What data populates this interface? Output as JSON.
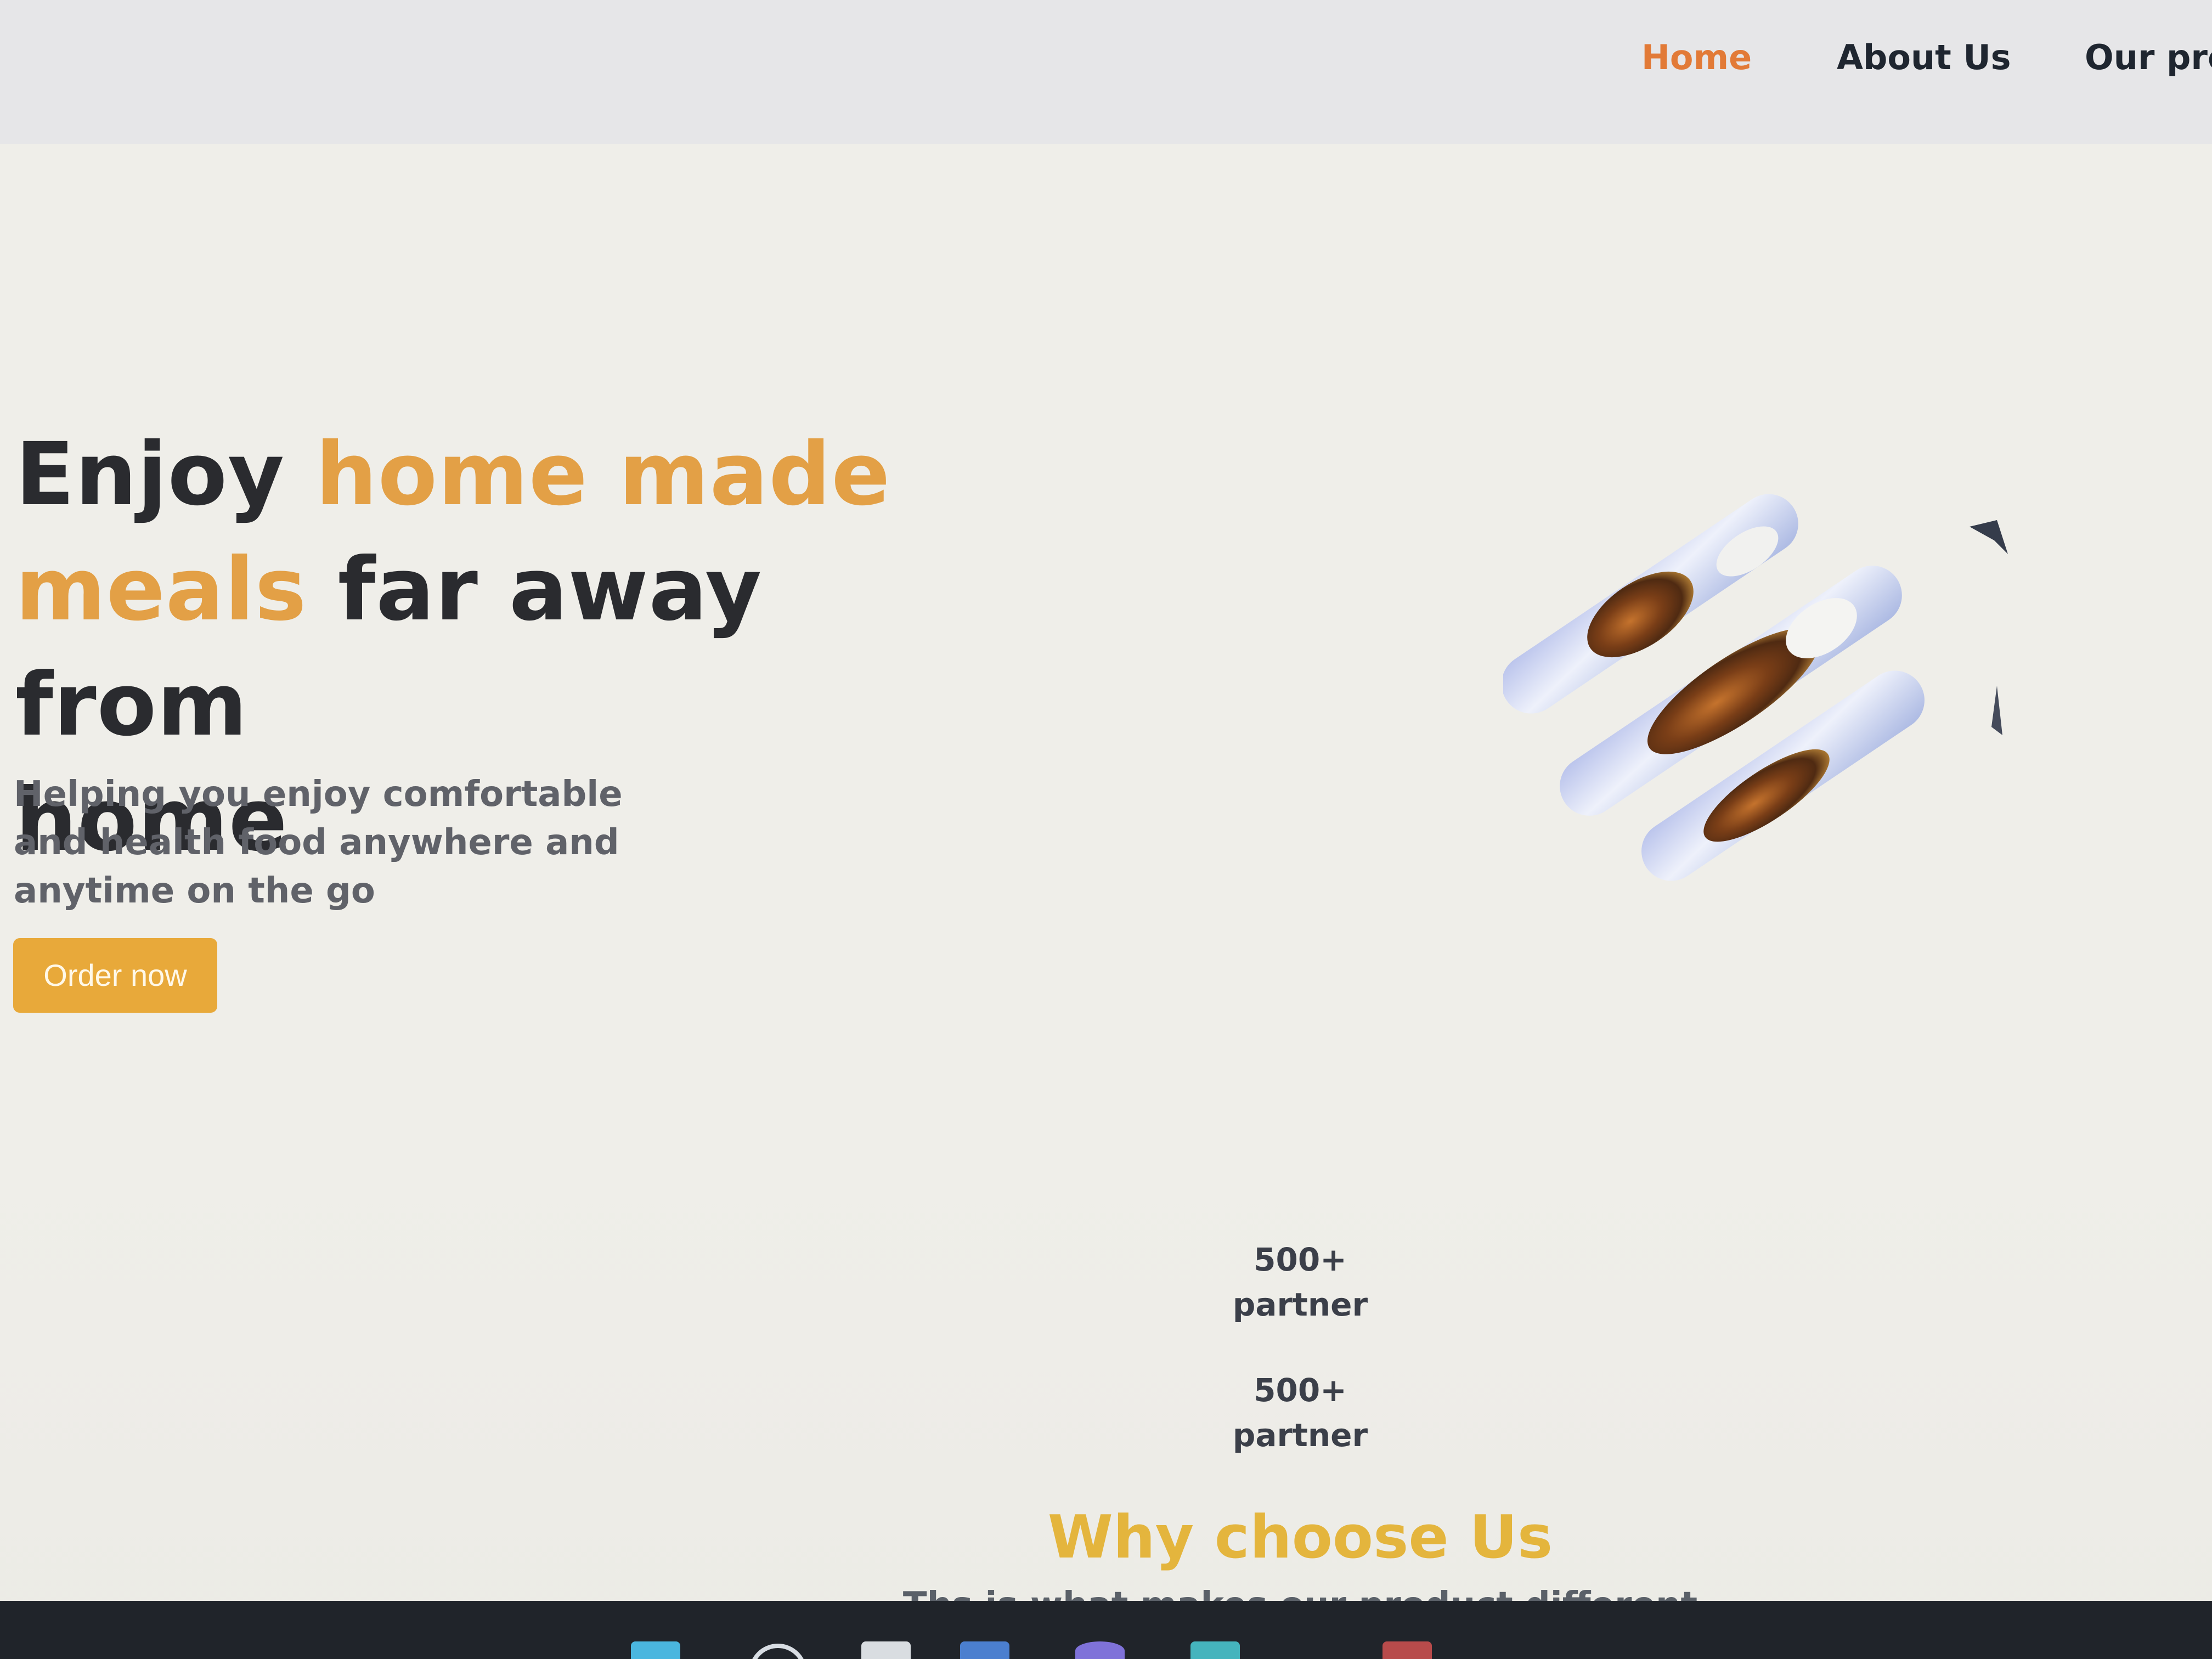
{
  "nav": {
    "items": [
      {
        "label": "Home",
        "active": true
      },
      {
        "label": "About Us",
        "active": false
      },
      {
        "label": "Our pro",
        "active": false
      }
    ],
    "active_color": "#e27a37"
  },
  "hero": {
    "title_parts": {
      "part1": "Enjoy ",
      "accent1": "home made",
      "accent2": "meals",
      "part2": " far away from",
      "part3": "home"
    },
    "subtitle": "Helping you enjoy comfortable and health food anywhere and anytime on the go",
    "cta_label": "Order now",
    "accent_color": "#e3a046",
    "button_color": "#e8a93a"
  },
  "stats": [
    {
      "value": "500+",
      "label": "partner"
    },
    {
      "value": "500+",
      "label": "partner"
    }
  ],
  "why_section": {
    "title": "Why choose Us",
    "subtitle": "Ths is what makes our product different",
    "title_color": "#e4b53d"
  },
  "taskbar": {
    "icons": [
      "windows-icon",
      "search-icon",
      "file-explorer-icon",
      "store-icon",
      "edge-icon",
      "app-icon",
      "app-icon"
    ]
  }
}
